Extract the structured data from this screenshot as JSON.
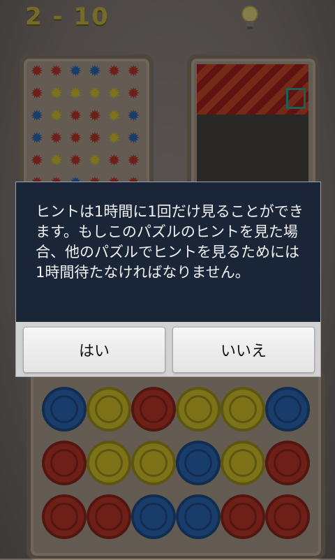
{
  "game": {
    "level": "2 - 10",
    "hint_icon": "lightbulb-icon",
    "star_colors": [
      "red",
      "red",
      "blue",
      "blue",
      "red",
      "red",
      "red",
      "yellow",
      "yellow",
      "yellow",
      "yellow",
      "red",
      "blue",
      "yellow",
      "red",
      "red",
      "yellow",
      "blue",
      "blue",
      "red",
      "red",
      "red",
      "yellow",
      "blue",
      "red",
      "yellow",
      "red",
      "yellow",
      "red",
      "red",
      "red",
      "red",
      "blue",
      "red",
      "red",
      "red"
    ],
    "gear_colors": [
      "blue",
      "yellow",
      "red",
      "yellow",
      "yellow",
      "blue",
      "red",
      "yellow",
      "yellow",
      "blue",
      "yellow",
      "red",
      "red",
      "red",
      "blue",
      "blue",
      "red",
      "red"
    ]
  },
  "dialog": {
    "message": "ヒントは1時間に1回だけ見ることができます。もしこのパズルのヒントを見た場合、他のパズルでヒントを見るためには1時間待たなければなりません。",
    "yes_label": "はい",
    "no_label": "いいえ"
  },
  "colors": {
    "red": "#c93a2b",
    "blue": "#2f6fc4",
    "yellow": "#e3cf2c",
    "dialog_bg": "#1b2538",
    "level_text": "#d3c34a"
  }
}
